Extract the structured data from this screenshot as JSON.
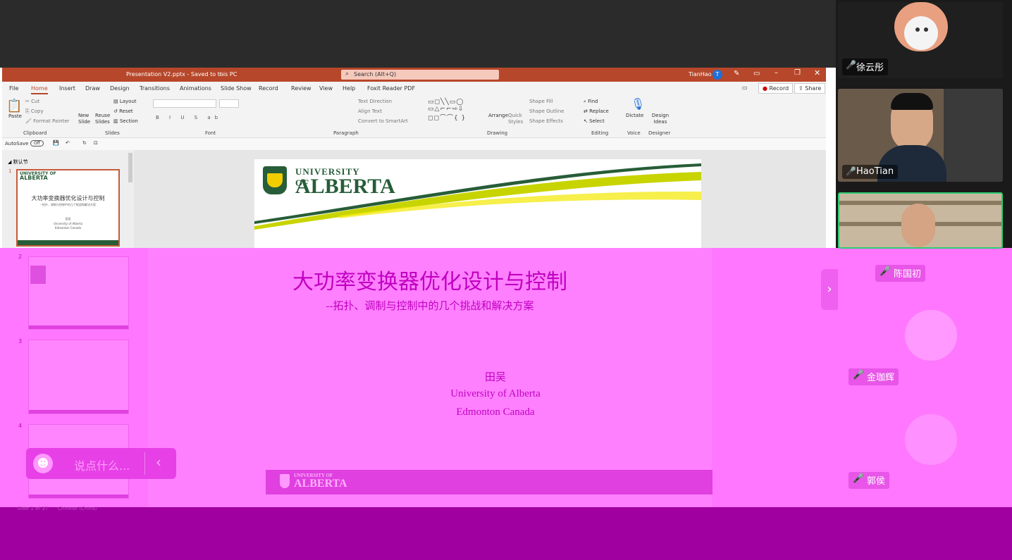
{
  "powerpoint": {
    "title": "Presentation V2.pptx - Saved to this PC",
    "search_placeholder": "Search (Alt+Q)",
    "user": "TianHao",
    "user_initial": "T",
    "menu": [
      "File",
      "Home",
      "Insert",
      "Draw",
      "Design",
      "Transitions",
      "Animations",
      "Slide Show",
      "Record",
      "Review",
      "View",
      "Help",
      "Foxit Reader PDF"
    ],
    "record_button": "Record",
    "share_button": "Share",
    "ribbon": {
      "paste": "Paste",
      "cut": "Cut",
      "copy": "Copy",
      "format_painter": "Format Painter",
      "clipboard": "Clipboard",
      "new_slide": "New Slide",
      "reuse_slides": "Reuse Slides",
      "layout": "Layout",
      "reset": "Reset",
      "section": "Section",
      "slides": "Slides",
      "font": "Font",
      "text_direction": "Text Direction",
      "align_text": "Align Text",
      "convert_smartart": "Convert to SmartArt",
      "paragraph": "Paragraph",
      "arrange": "Arrange",
      "quick_styles": "Quick Styles",
      "shape_fill": "Shape Fill",
      "shape_outline": "Shape Outline",
      "shape_effects": "Shape Effects",
      "drawing": "Drawing",
      "find": "Find",
      "replace": "Replace",
      "select": "Select",
      "editing": "Editing",
      "dictate": "Dictate",
      "voice": "Voice",
      "design_ideas": "Design Ideas",
      "designer": "Designer"
    },
    "autosave": "AutoSave",
    "autosave_state": "Off",
    "section_name": "默认节",
    "slide_numbers": [
      "1",
      "2",
      "3",
      "4"
    ],
    "status": "Slide 1 of 37",
    "language": "Chinese (China)"
  },
  "slide": {
    "university_top": "UNIVERSITY OF",
    "university_name": "ALBERTA",
    "title": "大功率变换器优化设计与控制",
    "subtitle": "--拓扑、调制与控制中的几个挑战和解决方案",
    "author": "田吴",
    "affiliation": "University of Alberta",
    "location": "Edmonton Canada"
  },
  "thumb1": {
    "title": "大功率变换器优化设计与控制",
    "subtitle": "--拓扑、调制与控制中的几个挑战和解决方案",
    "author": "田吴",
    "line1": "University of Alberta",
    "line2": "Edmonton Canada"
  },
  "participants": [
    "徐云彤",
    "HaoTian",
    "陈国初",
    "金珈辉",
    "郭侯"
  ],
  "chat": {
    "placeholder": "说点什么..."
  }
}
